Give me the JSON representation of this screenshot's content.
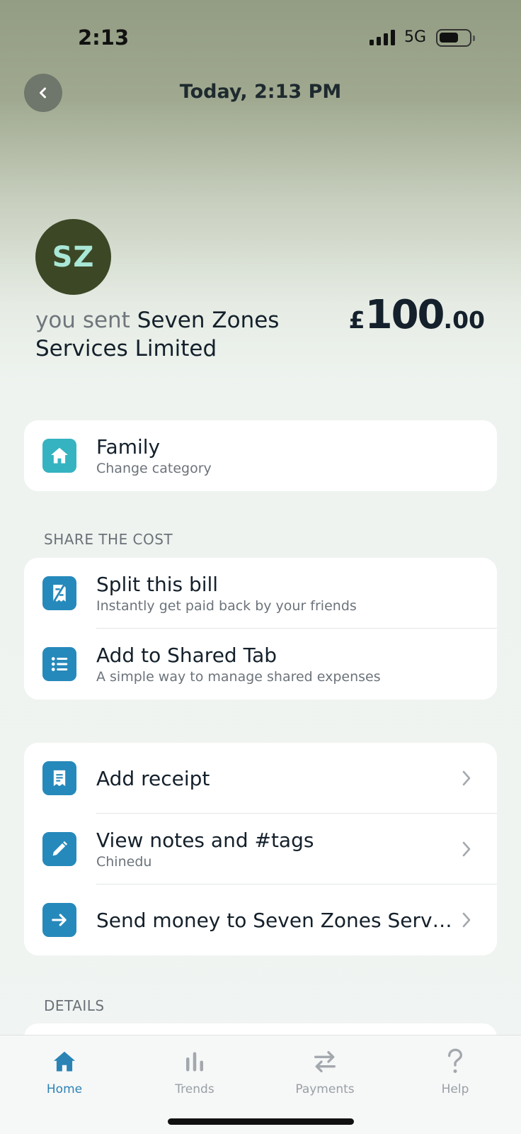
{
  "status_bar": {
    "time": "2:13",
    "network": "5G"
  },
  "header": {
    "title": "Today, 2:13 PM"
  },
  "merchant": {
    "initials": "SZ",
    "prefix": "you sent",
    "name": "Seven Zones Services Limited",
    "avatar_bg": "#3c4726",
    "avatar_fg": "#a9e7d6"
  },
  "amount": {
    "currency": "£",
    "integer": "100",
    "decimal": ".00"
  },
  "category": {
    "title": "Family",
    "subtitle": "Change category",
    "icon": "home-icon"
  },
  "share_section": {
    "label": "SHARE THE COST",
    "items": [
      {
        "title": "Split this bill",
        "subtitle": "Instantly get paid back by your friends",
        "icon": "split-bill-icon"
      },
      {
        "title": "Add to Shared Tab",
        "subtitle": "A simple way to manage shared expenses",
        "icon": "list-icon"
      }
    ]
  },
  "actions": {
    "items": [
      {
        "title": "Add receipt",
        "subtitle": "",
        "icon": "receipt-icon"
      },
      {
        "title": "View notes and #tags",
        "subtitle": "Chinedu",
        "icon": "pencil-icon"
      },
      {
        "title": "Send money to Seven Zones Servi…",
        "subtitle": "",
        "icon": "arrow-right-icon"
      }
    ]
  },
  "details_section": {
    "label": "DETAILS"
  },
  "tabbar": {
    "tabs": [
      {
        "label": "Home",
        "icon": "home-icon",
        "active": true
      },
      {
        "label": "Trends",
        "icon": "bar-chart-icon",
        "active": false
      },
      {
        "label": "Payments",
        "icon": "transfer-arrows-icon",
        "active": false
      },
      {
        "label": "Help",
        "icon": "question-icon",
        "active": false
      }
    ]
  },
  "colors": {
    "accent": "#2b83b5",
    "category_icon": "#36b3c1",
    "action_icon": "#2689bb",
    "text_primary": "#14202b",
    "text_secondary": "#6c737a"
  }
}
